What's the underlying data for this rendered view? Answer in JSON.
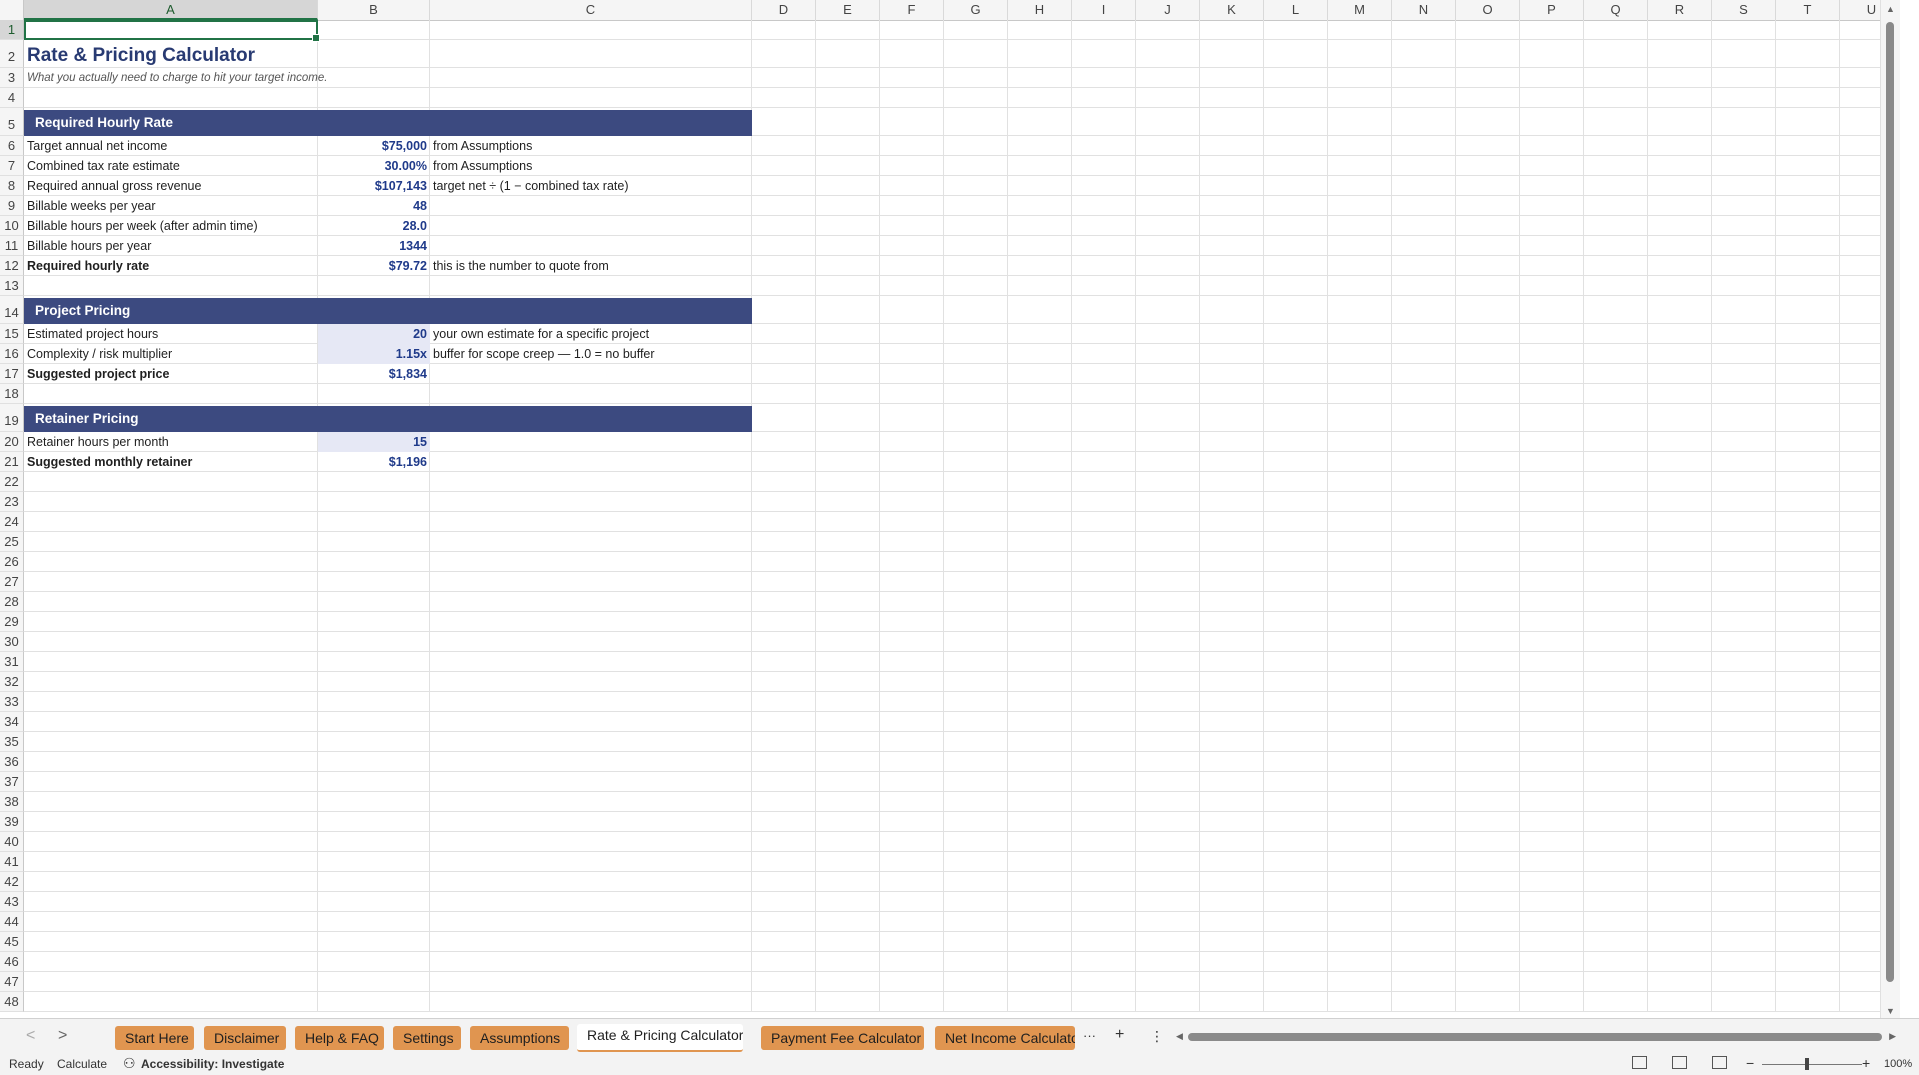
{
  "columns": [
    "A",
    "B",
    "C",
    "D",
    "E",
    "F",
    "G",
    "H",
    "I",
    "J",
    "K",
    "L",
    "M",
    "N",
    "O",
    "P",
    "Q",
    "R",
    "S",
    "T",
    "U"
  ],
  "rows": [
    "1",
    "2",
    "3",
    "4",
    "5",
    "6",
    "7",
    "8",
    "9",
    "10",
    "11",
    "12",
    "13",
    "14",
    "15",
    "16",
    "17",
    "18",
    "19",
    "20",
    "21",
    "22",
    "23",
    "24",
    "25",
    "26",
    "27",
    "28",
    "29",
    "30",
    "31",
    "32",
    "33",
    "34",
    "35",
    "36",
    "37",
    "38",
    "39",
    "40",
    "41",
    "42",
    "43",
    "44",
    "45",
    "46",
    "47",
    "48"
  ],
  "sheet": {
    "title": "Rate & Pricing Calculator",
    "subtitle": "What you actually need to charge to hit your target income.",
    "sections": {
      "hourly": "Required Hourly Rate",
      "project": "Project Pricing",
      "retainer": "Retainer Pricing"
    },
    "lines": [
      {
        "label": "Target annual net income",
        "value": "$75,000",
        "note": "from Assumptions",
        "bold": false,
        "input": false
      },
      {
        "label": "Combined tax rate estimate",
        "value": "30.00%",
        "note": "from Assumptions",
        "bold": false,
        "input": false
      },
      {
        "label": "Required annual gross revenue",
        "value": "$107,143",
        "note": "target net ÷ (1 − combined tax rate)",
        "bold": false,
        "input": false
      },
      {
        "label": "Billable weeks per year",
        "value": "48",
        "note": "",
        "bold": false,
        "input": false
      },
      {
        "label": "Billable hours per week (after admin time)",
        "value": "28.0",
        "note": "",
        "bold": false,
        "input": false
      },
      {
        "label": "Billable hours per year",
        "value": "1344",
        "note": "",
        "bold": false,
        "input": false
      },
      {
        "label": "Required hourly rate",
        "value": "$79.72",
        "note": "this is the number to quote from",
        "bold": true,
        "input": false
      },
      {
        "label": "Estimated project hours",
        "value": "20",
        "note": "your own estimate for a specific project",
        "bold": false,
        "input": true
      },
      {
        "label": "Complexity / risk multiplier",
        "value": "1.15x",
        "note": "buffer for scope creep — 1.0 = no buffer",
        "bold": false,
        "input": true
      },
      {
        "label": "Suggested project price",
        "value": "$1,834",
        "note": "",
        "bold": true,
        "input": false
      },
      {
        "label": "Retainer hours per month",
        "value": "15",
        "note": "",
        "bold": false,
        "input": true
      },
      {
        "label": "Suggested monthly retainer",
        "value": "$1,196",
        "note": "",
        "bold": true,
        "input": false
      }
    ]
  },
  "tabs": [
    {
      "label": "Start Here",
      "active": false
    },
    {
      "label": "Disclaimer",
      "active": false
    },
    {
      "label": "Help & FAQ",
      "active": false
    },
    {
      "label": "Settings",
      "active": false
    },
    {
      "label": "Assumptions",
      "active": false
    },
    {
      "label": "Rate & Pricing Calculator",
      "active": true
    },
    {
      "label": "Payment Fee Calculator",
      "active": false
    },
    {
      "label": "Net Income Calculato",
      "active": false
    }
  ],
  "tabbar": {
    "more": "···",
    "add": "+",
    "options": "⋮",
    "prev": "<",
    "next": ">"
  },
  "status": {
    "ready": "Ready",
    "calculate": "Calculate",
    "accessibility": "Accessibility: Investigate",
    "zoom": "100%",
    "zoom_out": "−",
    "zoom_in": "+"
  }
}
